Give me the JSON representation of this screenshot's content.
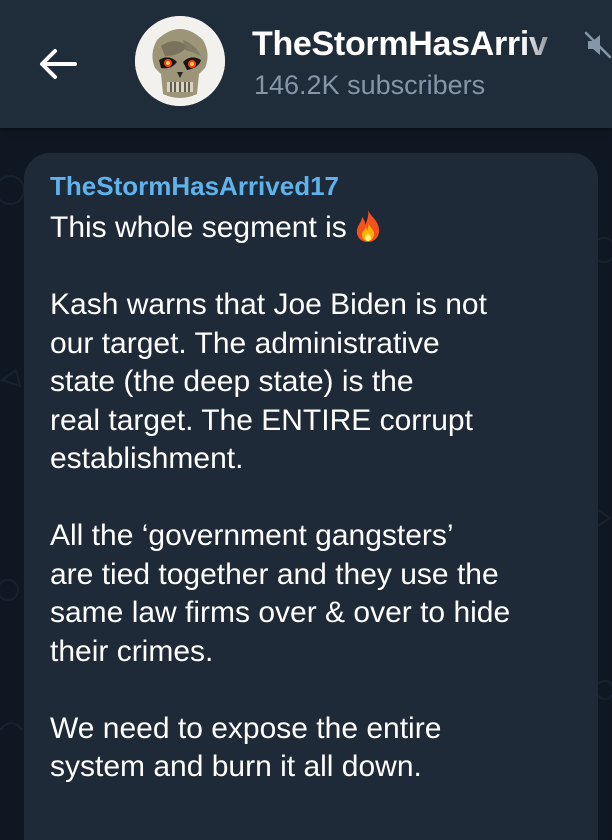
{
  "header": {
    "back_icon": "arrow-left-icon",
    "avatar_icon": "punisher-skull-avatar",
    "channel_title": "TheStormHasArriv",
    "subscriber_count": "146.2K subscribers",
    "mute_icon": "muted-speaker-icon"
  },
  "message": {
    "sender": "TheStormHasArrived17",
    "paragraphs": [
      "This whole segment is",
      "Kash warns that Joe Biden is not\nour target. The administrative\nstate (the deep state) is the\nreal target. The ENTIRE corrupt\nestablishment.",
      "All the ‘government gangsters’\nare tied together and they use the\nsame law firms over & over to hide\ntheir crimes.",
      "We need to expose the entire\nsystem and burn it all down."
    ],
    "emoji_icon": "fire-icon"
  },
  "colors": {
    "header_bg": "#1f2c3a",
    "chat_bg": "#0f1722",
    "bubble_bg": "#1e2a38",
    "sender_name": "#5fb3ec",
    "subtitle": "#8596a8",
    "text": "#ffffff"
  }
}
